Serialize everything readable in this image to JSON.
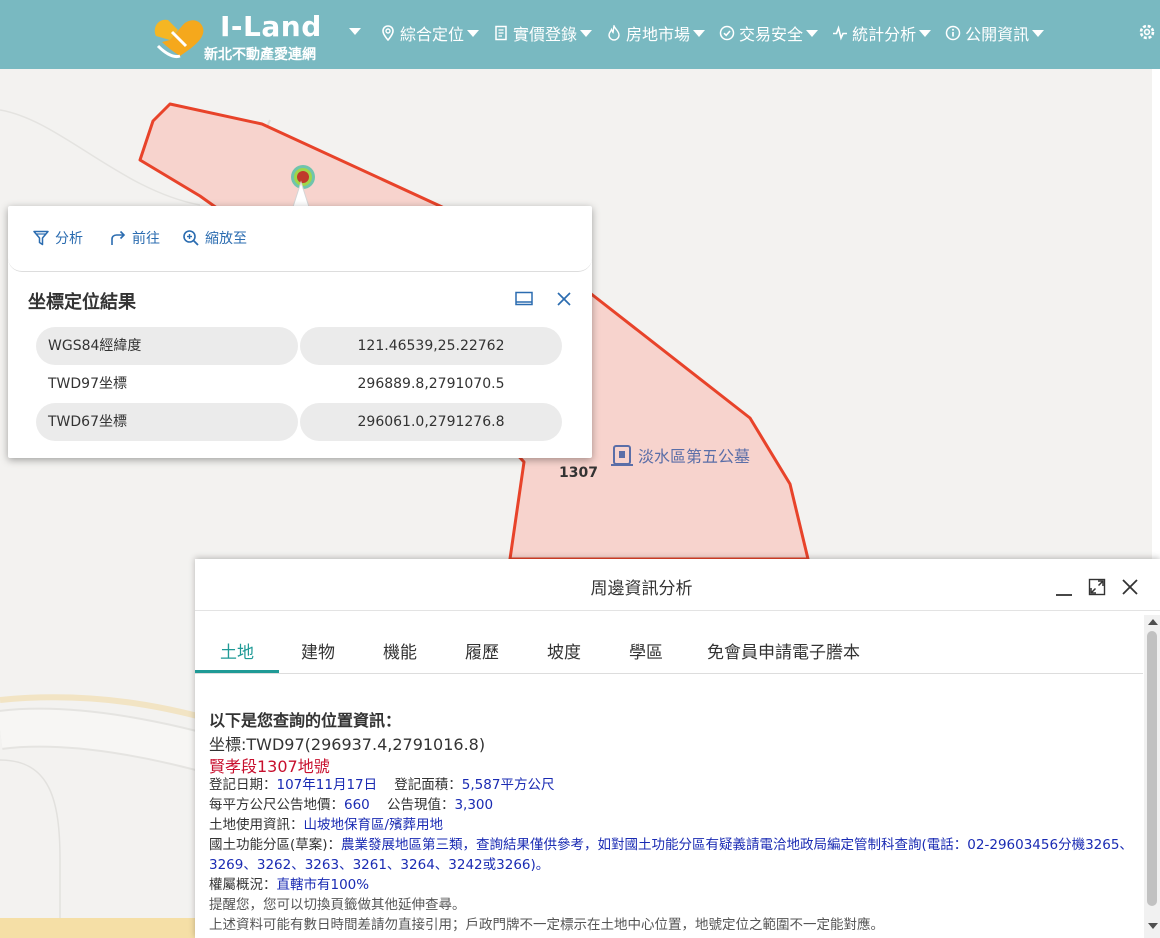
{
  "header": {
    "logo_title": "I-Land",
    "logo_subtitle": "新北不動產愛連網",
    "nav": [
      {
        "label": "綜合定位",
        "icon": "location-pin-icon"
      },
      {
        "label": "實價登錄",
        "icon": "document-icon"
      },
      {
        "label": "房地市場",
        "icon": "fire-icon"
      },
      {
        "label": "交易安全",
        "icon": "check-circle-icon"
      },
      {
        "label": "統計分析",
        "icon": "pulse-icon"
      },
      {
        "label": "公開資訊",
        "icon": "info-circle-icon"
      }
    ],
    "settings_icon": "gear-icon"
  },
  "map": {
    "parcel_label": "1307",
    "poi_label": "淡水區第五公墓",
    "colors": {
      "parcel_fill": "#f7d3cd",
      "parcel_stroke": "#e8432a",
      "marker": "#c0392b"
    }
  },
  "coord_popup": {
    "tools": [
      {
        "label": "分析",
        "icon": "filter-icon"
      },
      {
        "label": "前往",
        "icon": "forward-arrow-icon"
      },
      {
        "label": "縮放至",
        "icon": "zoom-in-icon"
      }
    ],
    "title": "坐標定位結果",
    "rows": [
      {
        "key": "WGS84經緯度",
        "value": "121.46539,25.22762"
      },
      {
        "key": "TWD97坐標",
        "value": "296889.8,2791070.5"
      },
      {
        "key": "TWD67坐標",
        "value": "296061.0,2791276.8"
      }
    ]
  },
  "panel": {
    "title": "周邊資訊分析",
    "tabs": [
      "土地",
      "建物",
      "機能",
      "履歷",
      "坡度",
      "學區",
      "免會員申請電子謄本"
    ],
    "active_tab": "土地",
    "heading": "以下是您查詢的位置資訊：",
    "coord_text": "坐標:TWD97(296937.4,2791016.8)",
    "lot": "賢孝段1307地號",
    "reg_date_label": "登記日期：",
    "reg_date": "107年11月17日",
    "reg_area_label": "登記面積：",
    "reg_area": "5,587平方公尺",
    "land_price_label": "每平方公尺公告地價：",
    "land_price": "660",
    "current_value_label": "公告現值：",
    "current_value": "3,300",
    "land_use_label": "土地使用資訊：",
    "land_use": "山坡地保育區/殯葬用地",
    "zoning_label": "國土功能分區(草案)：",
    "zoning": "農業發展地區第三類，查詢結果僅供參考，如對國土功能分區有疑義請電洽地政局編定管制科查詢(電話：02-29603456分機3265、3269、3262、3263、3261、3264、3242或3266)。",
    "ownership_label": "權屬概況：",
    "ownership": "直轄市有100%",
    "note1": "提醒您，您可以切換頁籤做其他延伸查尋。",
    "note2": "上述資料可能有數日時間差請勿直接引用；戶政門牌不一定標示在土地中心位置，地號定位之範圍不一定能對應。"
  }
}
